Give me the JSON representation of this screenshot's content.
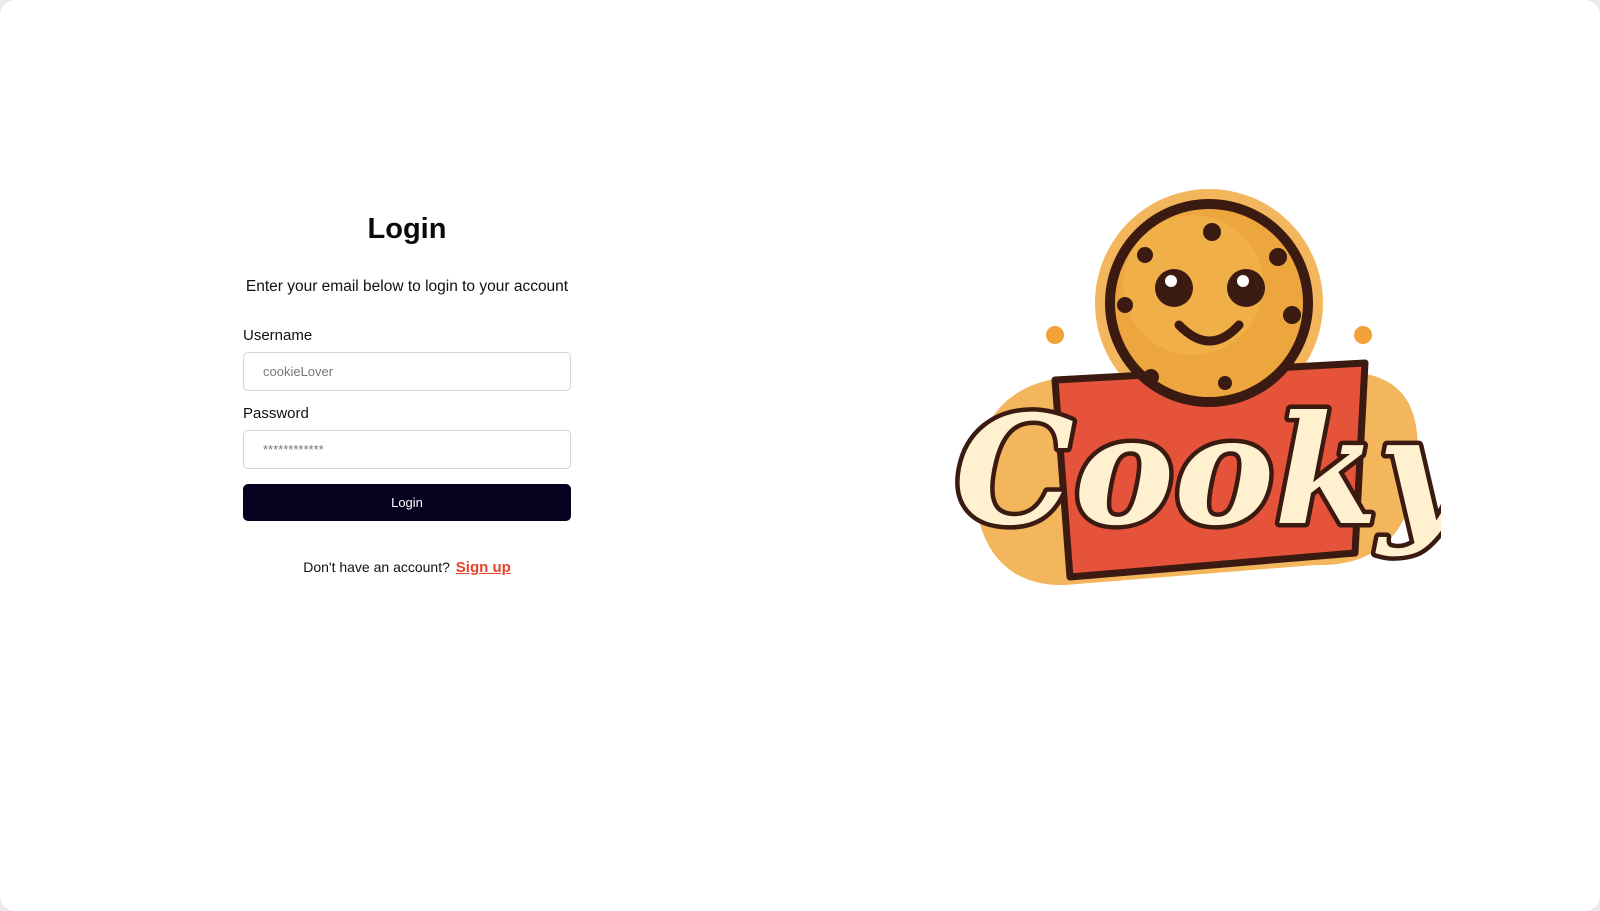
{
  "login": {
    "title": "Login",
    "subtitle": "Enter your email below to login to your account",
    "username_label": "Username",
    "username_placeholder": "cookieLover",
    "password_label": "Password",
    "password_placeholder": "************",
    "button_label": "Login",
    "signup_prompt": "Don't have an account?",
    "signup_link": "Sign up"
  },
  "logo": {
    "wordmark": "Cooky",
    "icon": "smiling-cookie-icon"
  },
  "colors": {
    "button_bg": "#05021f",
    "link": "#e8432b",
    "cookie": "#eda63d",
    "logo_outline": "#3b1a12",
    "ribbon": "#e5533a"
  }
}
